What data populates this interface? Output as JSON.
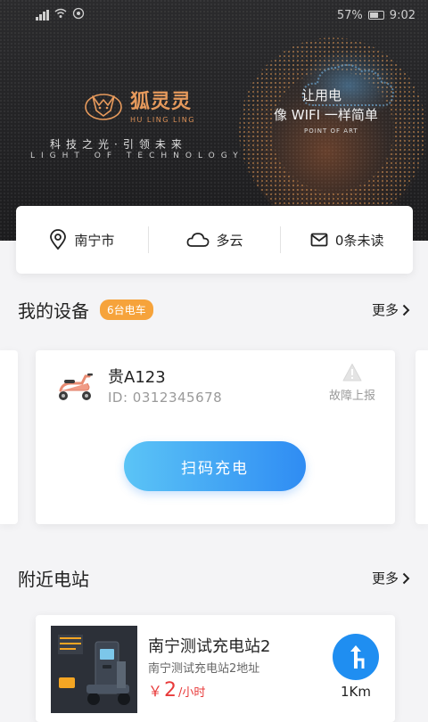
{
  "status_bar": {
    "battery": "57%",
    "time": "9:02"
  },
  "banner": {
    "logo_cn": "狐灵灵",
    "logo_en": "HU LING LING",
    "slogan_cn": "科技之光·引领未来",
    "slogan_en": "LIGHT OF TECHNOLOGY",
    "right_line1": "让用电",
    "right_line2": "像 WIFI 一样简单",
    "right_small": "POINT OF ART"
  },
  "info_bar": {
    "city": "南宁市",
    "weather": "多云",
    "messages": "0条未读"
  },
  "devices_section": {
    "title": "我的设备",
    "badge": "6台电车",
    "more": "更多"
  },
  "device": {
    "plate": "贵A123",
    "id_text": "ID:  0312345678",
    "fault_label": "故障上报",
    "scan_label": "扫码充电"
  },
  "stations_section": {
    "title": "附近电站",
    "more": "更多"
  },
  "station": {
    "name": "南宁测试充电站2",
    "address": "南宁测试充电站2地址",
    "price_symbol": "￥",
    "price_value": "2",
    "price_unit": "/小时",
    "distance": "1Km"
  },
  "colors": {
    "accent_blue": "#2f8cf3",
    "badge_orange": "#f6a33b",
    "price_red": "#e83a3a",
    "logo_orange": "#e79a5c"
  }
}
